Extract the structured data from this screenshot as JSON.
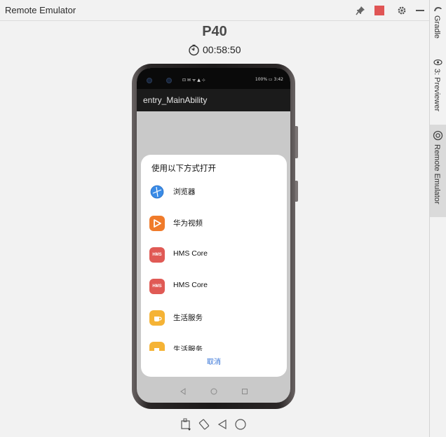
{
  "window": {
    "title": "Remote Emulator",
    "icons": [
      "pin-icon",
      "stop-icon",
      "gear-icon",
      "minimize-icon"
    ]
  },
  "side_tabs": [
    {
      "label": "Gradle",
      "icon": "gradle-icon"
    },
    {
      "label": "3: Previewer",
      "icon": "eye-icon"
    },
    {
      "label": "Remote Emulator",
      "icon": "emulator-icon",
      "active": true
    }
  ],
  "device": {
    "name": "P40",
    "timer": "00:58:50"
  },
  "phone": {
    "status_left": "⊡ ✉ ᯤ ▲ ⊹",
    "status_right": "100% ▭ 3:42",
    "app_title": "entry_MainAbility",
    "dialog": {
      "title": "使用以下方式打开",
      "items": [
        {
          "label": "浏览器",
          "icon": "browser-icon",
          "color": "#3a8be6"
        },
        {
          "label": "华为视频",
          "icon": "huawei-video-icon",
          "color": "#f07b2b"
        },
        {
          "label": "HMS Core",
          "icon": "hms-core-icon",
          "color": "#e05a55",
          "icon_text": "HMS"
        },
        {
          "label": "HMS Core",
          "icon": "hms-core-icon",
          "color": "#e05a55",
          "icon_text": "HMS"
        },
        {
          "label": "生活服务",
          "icon": "life-service-icon",
          "color": "#f5b335"
        },
        {
          "label": "生活服务",
          "icon": "life-service-icon",
          "color": "#f5b335"
        }
      ],
      "cancel": "取消"
    }
  },
  "bottom_toolbar": [
    "screenshot-icon",
    "rotate-icon",
    "back-icon",
    "home-icon"
  ]
}
